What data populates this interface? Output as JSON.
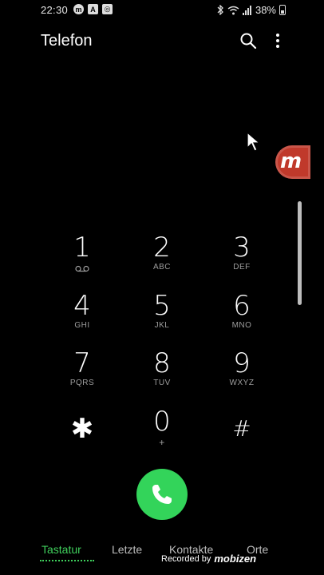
{
  "status": {
    "time": "22:30",
    "icons_left": [
      "m",
      "A",
      "◎"
    ],
    "battery": "38%"
  },
  "app": {
    "title": "Telefon"
  },
  "bubble": {
    "label": "m"
  },
  "keypad": [
    {
      "digit": "1",
      "letters": ""
    },
    {
      "digit": "2",
      "letters": "ABC"
    },
    {
      "digit": "3",
      "letters": "DEF"
    },
    {
      "digit": "4",
      "letters": "GHI"
    },
    {
      "digit": "5",
      "letters": "JKL"
    },
    {
      "digit": "6",
      "letters": "MNO"
    },
    {
      "digit": "7",
      "letters": "PQRS"
    },
    {
      "digit": "8",
      "letters": "TUV"
    },
    {
      "digit": "9",
      "letters": "WXYZ"
    },
    {
      "digit": "✱",
      "letters": ""
    },
    {
      "digit": "0",
      "letters": "+"
    },
    {
      "digit": "#",
      "letters": ""
    }
  ],
  "tabs": [
    {
      "label": "Tastatur",
      "active": true
    },
    {
      "label": "Letzte",
      "active": false
    },
    {
      "label": "Kontakte",
      "active": false
    },
    {
      "label": "Orte",
      "active": false
    }
  ],
  "watermark": {
    "text": "Recorded by",
    "brand": "mobizen"
  },
  "colors": {
    "accent": "#33d45a",
    "tab_active": "#3fcf5c",
    "bubble": "#c0392b"
  }
}
